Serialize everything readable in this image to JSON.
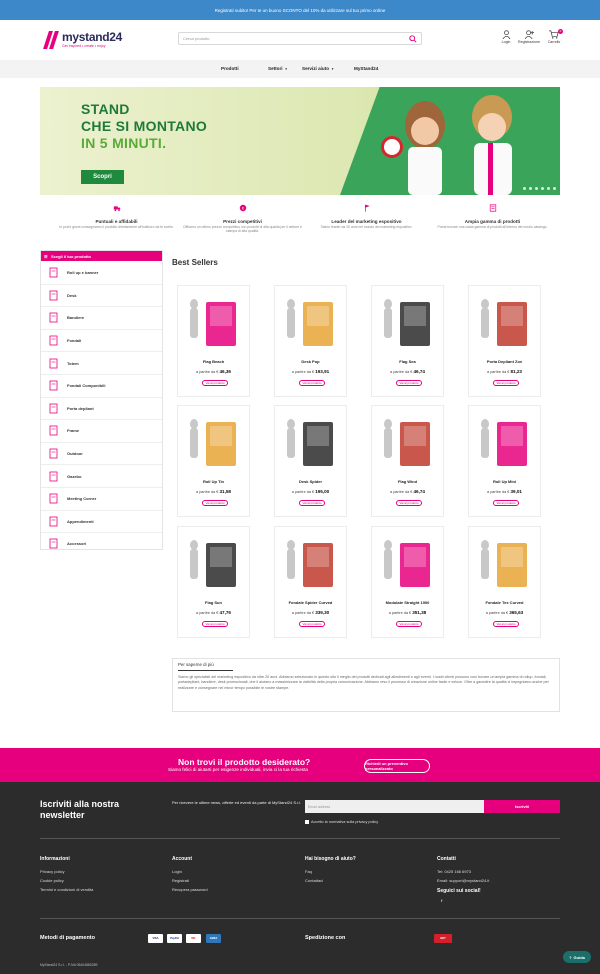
{
  "topbar": {
    "text": "Registrati subito! Per te un buono SCONTO del 10% da utilizzare sul tuo primo ordine"
  },
  "header": {
    "logo_text": "mystand24",
    "logo_sub": "Get Inspired • create • enjoy",
    "search_placeholder": "Cerca prodotto",
    "login_label": "Login",
    "register_label": "Registrazione",
    "cart_label": "Carrello",
    "cart_count": "0"
  },
  "nav": {
    "items": [
      "Prodotti",
      "Settori",
      "Servizi aiuto",
      "MyStand24"
    ]
  },
  "hero": {
    "line1": "STAND",
    "line2": "CHE SI MONTANO",
    "line3": "IN 5 MINUTI.",
    "button": "Scopri"
  },
  "features": [
    {
      "title": "Puntuali e affidabili",
      "desc": "In pochi giorni consegniamo il prodotto direttamente all'indirizzo da te scelto."
    },
    {
      "title": "Prezzi competitivi",
      "desc": "Offriamo un ottimo prezzo competitivo con prodotti di alta qualità per il settore e stampa di alta qualità."
    },
    {
      "title": "Leader del marketing espositivo",
      "desc": "Siamo leader da 20 anni nel mondo del marketing espositivo."
    },
    {
      "title": "Ampia gamma di prodotti",
      "desc": "Potrai trovare una vasta gamma di prodotti all'interno del nostro catalogo."
    }
  ],
  "sidebar": {
    "title": "Scegli il tuo prodotto",
    "items": [
      "Roll up e banner",
      "Desk",
      "Bandiere",
      "Fondali",
      "Totem",
      "Fondali Componibili",
      "Porta depliant",
      "Frame",
      "Outdoor",
      "Gazebo",
      "Meeting Corner",
      "Appendimenti",
      "Accessori"
    ]
  },
  "best_sellers": {
    "title": "Best Sellers",
    "price_prefix": "a partire da €",
    "button": "Vai al prodotto",
    "products": [
      {
        "name": "Flag Beach",
        "price": "46,36"
      },
      {
        "name": "Desk Pop",
        "price": "193,91"
      },
      {
        "name": "Flag Sea",
        "price": "46,74"
      },
      {
        "name": "Porta Depliant Zoe",
        "price": "81,23"
      },
      {
        "name": "Roll Up Tin",
        "price": "31,58"
      },
      {
        "name": "Desk Spider",
        "price": "195,00"
      },
      {
        "name": "Flag Wind",
        "price": "46,74"
      },
      {
        "name": "Roll Up Mini",
        "price": "39,01"
      },
      {
        "name": "Flag Sun",
        "price": "47,76"
      },
      {
        "name": "Fondale Spider Curved",
        "price": "339,30"
      },
      {
        "name": "Modulate Straight 1900",
        "price": "351,38"
      },
      {
        "name": "Fondale Tex Curved",
        "price": "365,63"
      }
    ]
  },
  "info": {
    "tab": "Per saperne di più",
    "text": "Siamo gli specialisti del marketing espositivo da oltre 20 anni. Abbiamo selezionato in questo sito il meglio dei prodotti dedicati agli allestimenti e agli eventi. I nostri clienti possono così trovare un'ampia gamma di rollup, fondali, portadepliant, bandiere, desk promozionali, che li aiutano a massimizzare la visibilità della propria comunicazione. Abbiamo reso il processo di creazione online facile e veloce. Oltre a garantire la qualità ci impegniamo anche per realizzare e consegnare nel minor tempo possibile le vostre stampe."
  },
  "promo": {
    "title": "Non trovi il prodotto desiderato?",
    "subtitle": "Siamo felici di aiutarti per esigenze individuali, invia ci la tua richiesta",
    "button": "Richiedi un preventivo personalizzato"
  },
  "newsletter": {
    "title_line1": "Iscriviti alla nostra",
    "title_line2": "newsletter",
    "desc": "Per ricevere le ultime news, offerte ed eventi da parte di MyStand24 S.r.l.",
    "placeholder": "Email address",
    "button": "Iscriviti",
    "consent": "Accetto la normativa sulla privacy policy"
  },
  "footer": {
    "info": {
      "title": "Informazioni",
      "links": [
        "Privacy policy",
        "Cookie policy",
        "Termini e condizioni di vendita"
      ]
    },
    "account": {
      "title": "Account",
      "links": [
        "Login",
        "Registrati",
        "Recupera password"
      ]
    },
    "help": {
      "title": "Hai bisogno di aiuto?",
      "links": [
        "Faq",
        "Contattaci"
      ]
    },
    "contacts": {
      "title": "Contatti",
      "lines": [
        "Tel: 0425 166 6973",
        "Email: support@mystand24.it"
      ],
      "social_title": "Seguici sui social!",
      "social_icon": "f"
    },
    "payment_title": "Metodi di pagamento",
    "cards": [
      "VISA",
      "PayPal",
      "MC",
      "AMEX"
    ],
    "shipping_title": "Spedizione con",
    "shipping_logo": "BRT",
    "copyright": "MyStand24 S.r.l. - P.IVA 05404880289"
  },
  "guide": {
    "label": "Guida"
  },
  "colors": {
    "brand": "#e6007e",
    "topbar": "#3d88c8",
    "hero_green": "#1f8a3d",
    "footer": "#2c2c2c"
  }
}
